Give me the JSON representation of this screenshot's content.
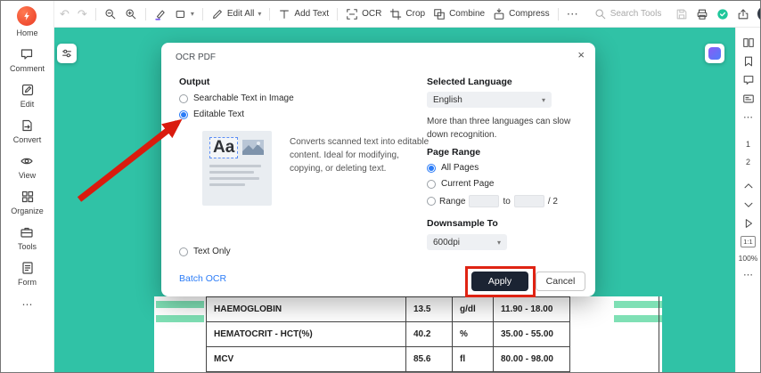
{
  "sidebar": {
    "items": [
      {
        "label": "Home"
      },
      {
        "label": "Comment"
      },
      {
        "label": "Edit"
      },
      {
        "label": "Convert"
      },
      {
        "label": "View"
      },
      {
        "label": "Organize"
      },
      {
        "label": "Tools"
      },
      {
        "label": "Form"
      }
    ],
    "more": "⋯"
  },
  "toolbar": {
    "undo": "↶",
    "redo": "↷",
    "edit_all": "Edit All",
    "add_text": "Add Text",
    "ocr": "OCR",
    "crop": "Crop",
    "combine": "Combine",
    "compress": "Compress",
    "more": "⋯",
    "search_placeholder": "Search Tools"
  },
  "icons": {
    "dropdown_arrow": "▾",
    "close": "×"
  },
  "rightbar": {
    "pages": [
      "1",
      "2"
    ],
    "ratio": "1:1",
    "zoom": "100%",
    "more": "⋯"
  },
  "dialog": {
    "title": "OCR PDF",
    "output_label": "Output",
    "options": [
      {
        "label": "Searchable Text in Image",
        "selected": false
      },
      {
        "label": "Editable Text",
        "selected": true
      },
      {
        "label": "Text Only",
        "selected": false
      }
    ],
    "preview_text": "Aa",
    "description": "Converts scanned text into editable content. Ideal for modifying, copying, or deleting text.",
    "batch_ocr": "Batch OCR",
    "language_label": "Selected Language",
    "language_value": "English",
    "language_note": "More than three languages can slow down recognition.",
    "page_range_label": "Page Range",
    "page_options": [
      {
        "label": "All Pages",
        "selected": true
      },
      {
        "label": "Current Page",
        "selected": false
      },
      {
        "label": "Range",
        "selected": false
      }
    ],
    "range_to": "to",
    "range_total": "/ 2",
    "downsample_label": "Downsample To",
    "downsample_value": "600dpi",
    "apply_label": "Apply",
    "cancel_label": "Cancel"
  },
  "document": {
    "table_rows": [
      [
        "HAEMOGLOBIN",
        "13.5",
        "g/dl",
        "11.90 - 18.00"
      ],
      [
        "HEMATOCRIT - HCT(%)",
        "40.2",
        "%",
        "35.00 - 55.00"
      ],
      [
        "MCV",
        "85.6",
        "fl",
        "80.00 - 98.00"
      ]
    ]
  },
  "colors": {
    "canvas_teal": "#30C2A6",
    "stripe_mint": "#7FE0B5",
    "accent_blue": "#2B7CF7",
    "annotation_red": "#DF2313",
    "apply_dark": "#1B2433",
    "logo_red": "#EA3B24"
  }
}
